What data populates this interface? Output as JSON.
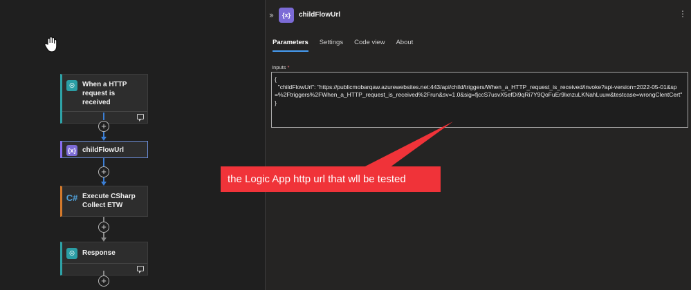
{
  "canvas": {
    "nodes": [
      {
        "label": "When a HTTP request is received",
        "icon": "http-request-icon"
      },
      {
        "label": "childFlowUrl",
        "icon": "variable-icon"
      },
      {
        "label": "Execute CSharp Collect ETW",
        "icon": "csharp-icon"
      },
      {
        "label": "Response",
        "icon": "http-response-icon"
      }
    ],
    "add_step_symbol": "+"
  },
  "panel": {
    "title": "childFlowUrl",
    "icon_glyph": "{x}",
    "tabs": [
      {
        "label": "Parameters",
        "active": true
      },
      {
        "label": "Settings",
        "active": false
      },
      {
        "label": "Code view",
        "active": false
      },
      {
        "label": "About",
        "active": false
      }
    ],
    "inputs_label": "Inputs",
    "inputs_required_mark": "*",
    "inputs_value": "{\n  \"childFlowUrl\": \"https://publicmobarqaw.azurewebsites.net:443/api/child/triggers/When_a_HTTP_request_is_received/invoke?api-version=2022-05-01&sp=%2Ftriggers%2FWhen_a_HTTP_request_is_received%2Frun&sv=1.0&sig=fjccS7usvX5efDi9qRi7Y9QoFuEr9lxnzuLKNahLuuw&testcase=wrongClentCert\"\n}"
  },
  "annotation": {
    "text": "the Logic App http url that wll be tested",
    "color": "#f03339"
  }
}
